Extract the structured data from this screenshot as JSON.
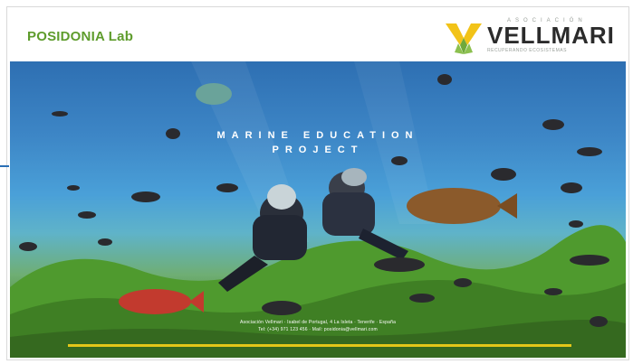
{
  "header": {
    "brand": "POSIDONIA Lab",
    "org_top": "ASOCIACIÓN",
    "org_name": "VELLMARI",
    "org_sub": "RECUPERANDO ECOSISTEMAS"
  },
  "hero": {
    "headline_line1": "MARINE EDUCATION",
    "headline_line2": "PROJECT",
    "footer_line1": "Asociación Vellmari · Isabel de Portugal, 4 La Isleta · Tenerife · España",
    "footer_line2": "Tel: (+34) 971 123 456 · Mail: posidonia@vellmari.com"
  },
  "colors": {
    "brand_green": "#5e9c2c",
    "logo_yellow": "#f2c318",
    "logo_green": "#6fa93b",
    "rule_yellow": "#e3c619"
  },
  "icons": {
    "logo": "vellmari-v-logo"
  }
}
